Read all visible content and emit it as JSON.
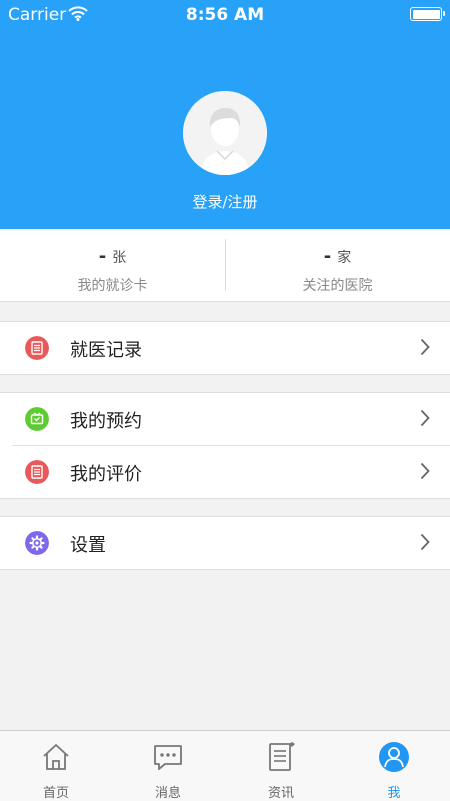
{
  "status_bar": {
    "carrier": "Carrier",
    "time": "8:56 AM"
  },
  "profile": {
    "login_label": "登录/注册"
  },
  "stats": [
    {
      "count": "-",
      "unit": "张",
      "label": "我的就诊卡"
    },
    {
      "count": "-",
      "unit": "家",
      "label": "关注的医院"
    }
  ],
  "menu": {
    "medical_records": "就医记录",
    "my_appointments": "我的预约",
    "my_reviews": "我的评价",
    "settings": "设置"
  },
  "tabs": [
    {
      "label": "首页",
      "icon": "home-icon"
    },
    {
      "label": "消息",
      "icon": "message-icon"
    },
    {
      "label": "资讯",
      "icon": "news-icon"
    },
    {
      "label": "我",
      "icon": "user-icon",
      "active": true
    }
  ],
  "colors": {
    "primary": "#27a2f8",
    "red_icon": "#e8595a",
    "green_icon": "#5fcb32",
    "purple_icon": "#7c6ae8",
    "active_tab": "#2196f3"
  }
}
